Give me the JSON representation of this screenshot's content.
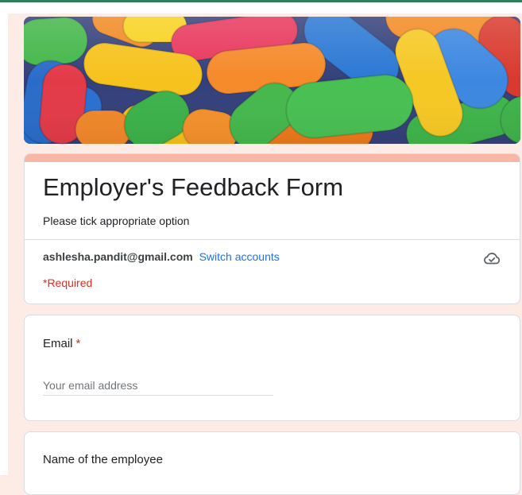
{
  "form": {
    "title": "Employer's Feedback Form",
    "description": "Please tick appropriate option"
  },
  "account": {
    "email": "ashlesha.pandit@gmail.com",
    "switch_label": "Switch accounts",
    "required_note": "*Required"
  },
  "questions": [
    {
      "label": "Email",
      "required_mark": "*",
      "placeholder": "Your email address"
    },
    {
      "label": "Name of the employee"
    }
  ],
  "icons": {
    "cloud": "cloud-saved-icon"
  },
  "colors": {
    "accent": "#f8b7a5",
    "page_background": "#fdece6",
    "link": "#1a73e8",
    "required": "#d93025",
    "top_rule": "#2e7d5b"
  }
}
